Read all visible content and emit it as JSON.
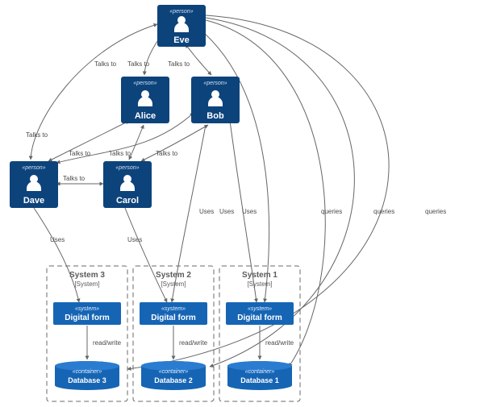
{
  "diagram_type": "C4-style context diagram",
  "stereotypes": {
    "person": "«person»",
    "system": "«system»",
    "container": "«container»"
  },
  "persons": [
    {
      "id": "eve",
      "name": "Eve"
    },
    {
      "id": "alice",
      "name": "Alice"
    },
    {
      "id": "bob",
      "name": "Bob"
    },
    {
      "id": "dave",
      "name": "Dave"
    },
    {
      "id": "carol",
      "name": "Carol"
    }
  ],
  "boundaries": [
    {
      "id": "b3",
      "title": "System 3",
      "type": "[System]",
      "sys": {
        "name": "Digital form"
      },
      "db": {
        "name": "Database 3"
      }
    },
    {
      "id": "b2",
      "title": "System 2",
      "type": "[System]",
      "sys": {
        "name": "Digital form"
      },
      "db": {
        "name": "Database 2"
      }
    },
    {
      "id": "b1",
      "title": "System 1",
      "type": "[System]",
      "sys": {
        "name": "Digital form"
      },
      "db": {
        "name": "Database 1"
      }
    }
  ],
  "edge_labels": {
    "talks": "Talks to",
    "uses": "Uses",
    "queries": "queries",
    "rw": "read/write"
  },
  "edges": [
    {
      "from": "eve",
      "to": "dave",
      "label": "Talks to",
      "both": true
    },
    {
      "from": "eve",
      "to": "alice",
      "label": "Talks to",
      "both": true
    },
    {
      "from": "eve",
      "to": "bob",
      "label": "Talks to",
      "both": true
    },
    {
      "from": "alice",
      "to": "dave",
      "label": "Talks to",
      "both": true
    },
    {
      "from": "alice",
      "to": "carol",
      "label": "Talks to",
      "both": true
    },
    {
      "from": "bob",
      "to": "dave",
      "label": "Talks to",
      "both": true
    },
    {
      "from": "bob",
      "to": "carol",
      "label": "Talks to",
      "both": true
    },
    {
      "from": "dave",
      "to": "carol",
      "label": "Talks to",
      "both": true
    },
    {
      "from": "dave",
      "to": "sys3.form",
      "label": "Uses"
    },
    {
      "from": "carol",
      "to": "sys2.form",
      "label": "Uses"
    },
    {
      "from": "bob",
      "to": "sys2.form",
      "label": "Uses"
    },
    {
      "from": "bob",
      "to": "sys1.form",
      "label": "Uses"
    },
    {
      "from": "eve",
      "to": "sys1.form",
      "label": "Uses"
    },
    {
      "from": "eve",
      "to": "db1",
      "label": "queries"
    },
    {
      "from": "eve",
      "to": "db2",
      "label": "queries"
    },
    {
      "from": "eve",
      "to": "db3",
      "label": "queries"
    },
    {
      "from": "sys3.form",
      "to": "db3",
      "label": "read/write"
    },
    {
      "from": "sys2.form",
      "to": "db2",
      "label": "read/write"
    },
    {
      "from": "sys1.form",
      "to": "db1",
      "label": "read/write"
    }
  ]
}
